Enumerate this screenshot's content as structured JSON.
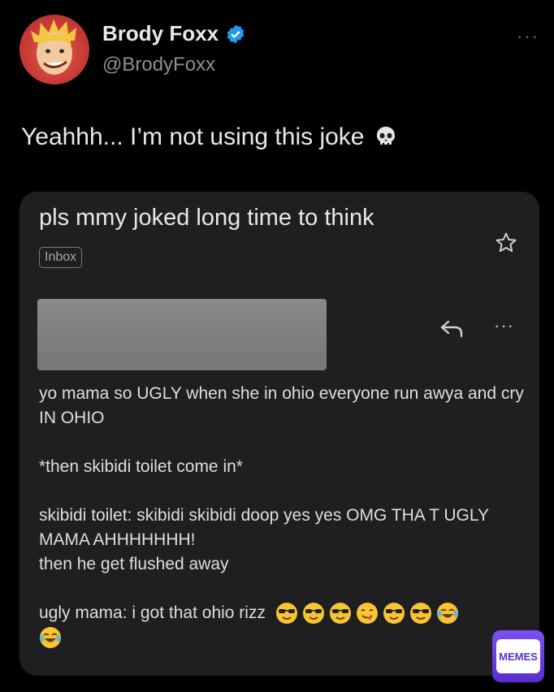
{
  "tweet": {
    "author_name": "Brody Foxx",
    "handle": "@BrodyFoxx",
    "more_label": "···",
    "text": "Yeahhh... I’m not using this joke",
    "text_emoji": "skull-emoji"
  },
  "email": {
    "subject": "pls mmy joked long time to think",
    "label": "Inbox",
    "more_label": "···",
    "lines": [
      "yo mama so UGLY when she in ohio  everyone run awya and cry IN OHIO",
      "*then skibidi toilet come in*",
      "skibidi toilet: skibidi skibidi doop yes yes OMG THA T UGLY MAMA  AHHHHHHH!",
      "then he get flushed away",
      "ugly mama: i got that ohio rizz"
    ],
    "trailing_emojis": [
      "sunglasses-emoji",
      "sunglasses-emoji",
      "sunglasses-emoji",
      "yum-emoji",
      "sunglasses-emoji",
      "sunglasses-emoji",
      "joy-emoji",
      "joy-emoji"
    ]
  },
  "watermark": {
    "label": "MEMES"
  },
  "colors": {
    "verified": "#1d9bf0",
    "background": "#000000",
    "card": "#1f1f21",
    "watermark": "#6a3be6"
  }
}
